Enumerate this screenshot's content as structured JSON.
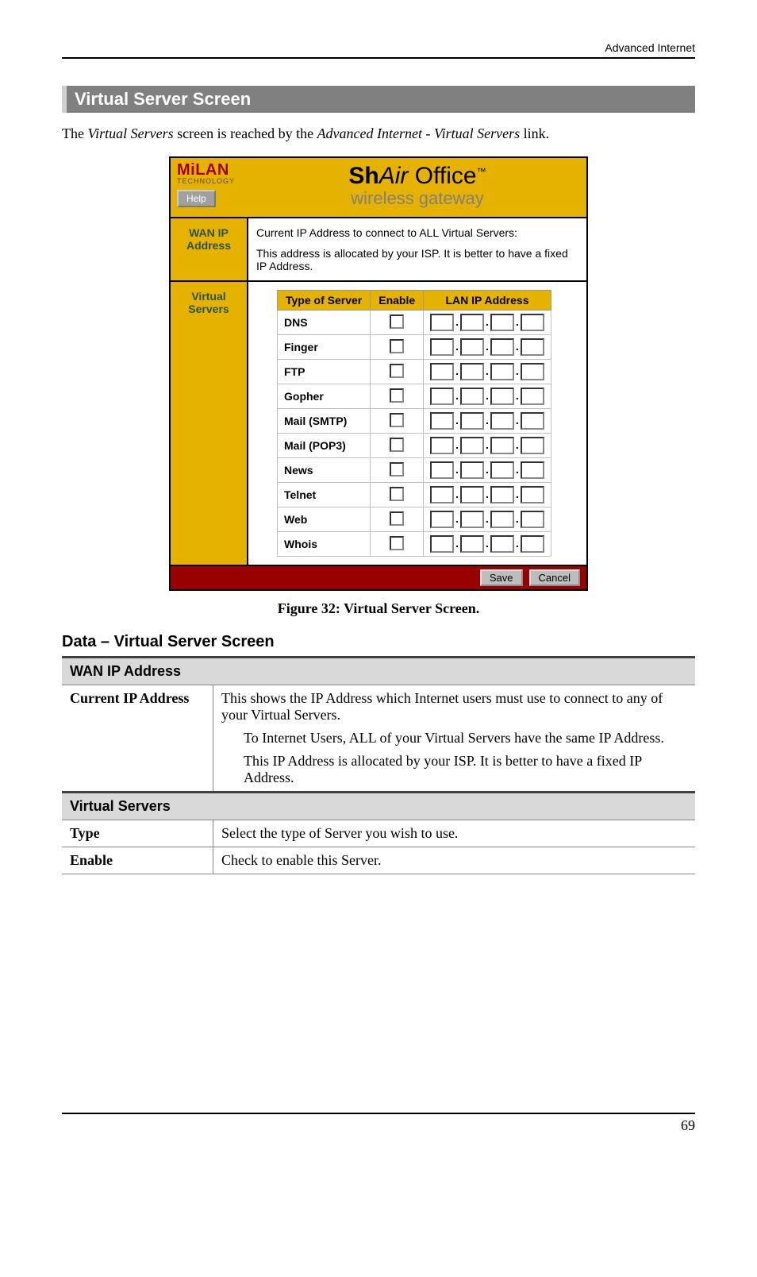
{
  "header_label": "Advanced Internet",
  "section_title": "Virtual Server Screen",
  "intro_parts": {
    "p1": "The ",
    "p2": "Virtual Servers",
    "p3": " screen is reached by the ",
    "p4": "Advanced Internet - Virtual Servers",
    "p5": " link."
  },
  "shot": {
    "brand": "MiLAN",
    "brand_sub": "TECHNOLOGY",
    "help": "Help",
    "title_bold": "Sh",
    "title_italic": "Air",
    "title_rest": " Office",
    "tm": "™",
    "subtitle": "wireless gateway",
    "wan_side": "WAN IP\nAddress",
    "wan_line1": "Current IP Address to connect to ALL Virtual Servers:",
    "wan_line2": "This address is allocated by your ISP. It is better to have a fixed IP Address.",
    "vs_side": "Virtual\nServers",
    "table_headers": {
      "type": "Type of Server",
      "enable": "Enable",
      "lan": "LAN IP Address"
    },
    "server_types": [
      "DNS",
      "Finger",
      "FTP",
      "Gopher",
      "Mail (SMTP)",
      "Mail (POP3)",
      "News",
      "Telnet",
      "Web",
      "Whois"
    ],
    "save": "Save",
    "cancel": "Cancel"
  },
  "figure_caption": "Figure 32: Virtual Server Screen.",
  "data_heading": "Data – Virtual Server Screen",
  "data_table": {
    "wan_header": "WAN IP Address",
    "current_ip_label": "Current IP Address",
    "current_ip_desc_main": "This shows the IP Address which Internet users must use to connect to any of your Virtual Servers.",
    "current_ip_desc_b1": "To Internet Users, ALL of your Virtual Servers have the same IP Address.",
    "current_ip_desc_b2": "This IP Address is allocated by your ISP. It is better to have a fixed IP Address.",
    "vs_header": "Virtual Servers",
    "type_label": "Type",
    "type_desc": "Select the type of Server you wish to use.",
    "enable_label": "Enable",
    "enable_desc": "Check to enable this Server."
  },
  "page_number": "69"
}
